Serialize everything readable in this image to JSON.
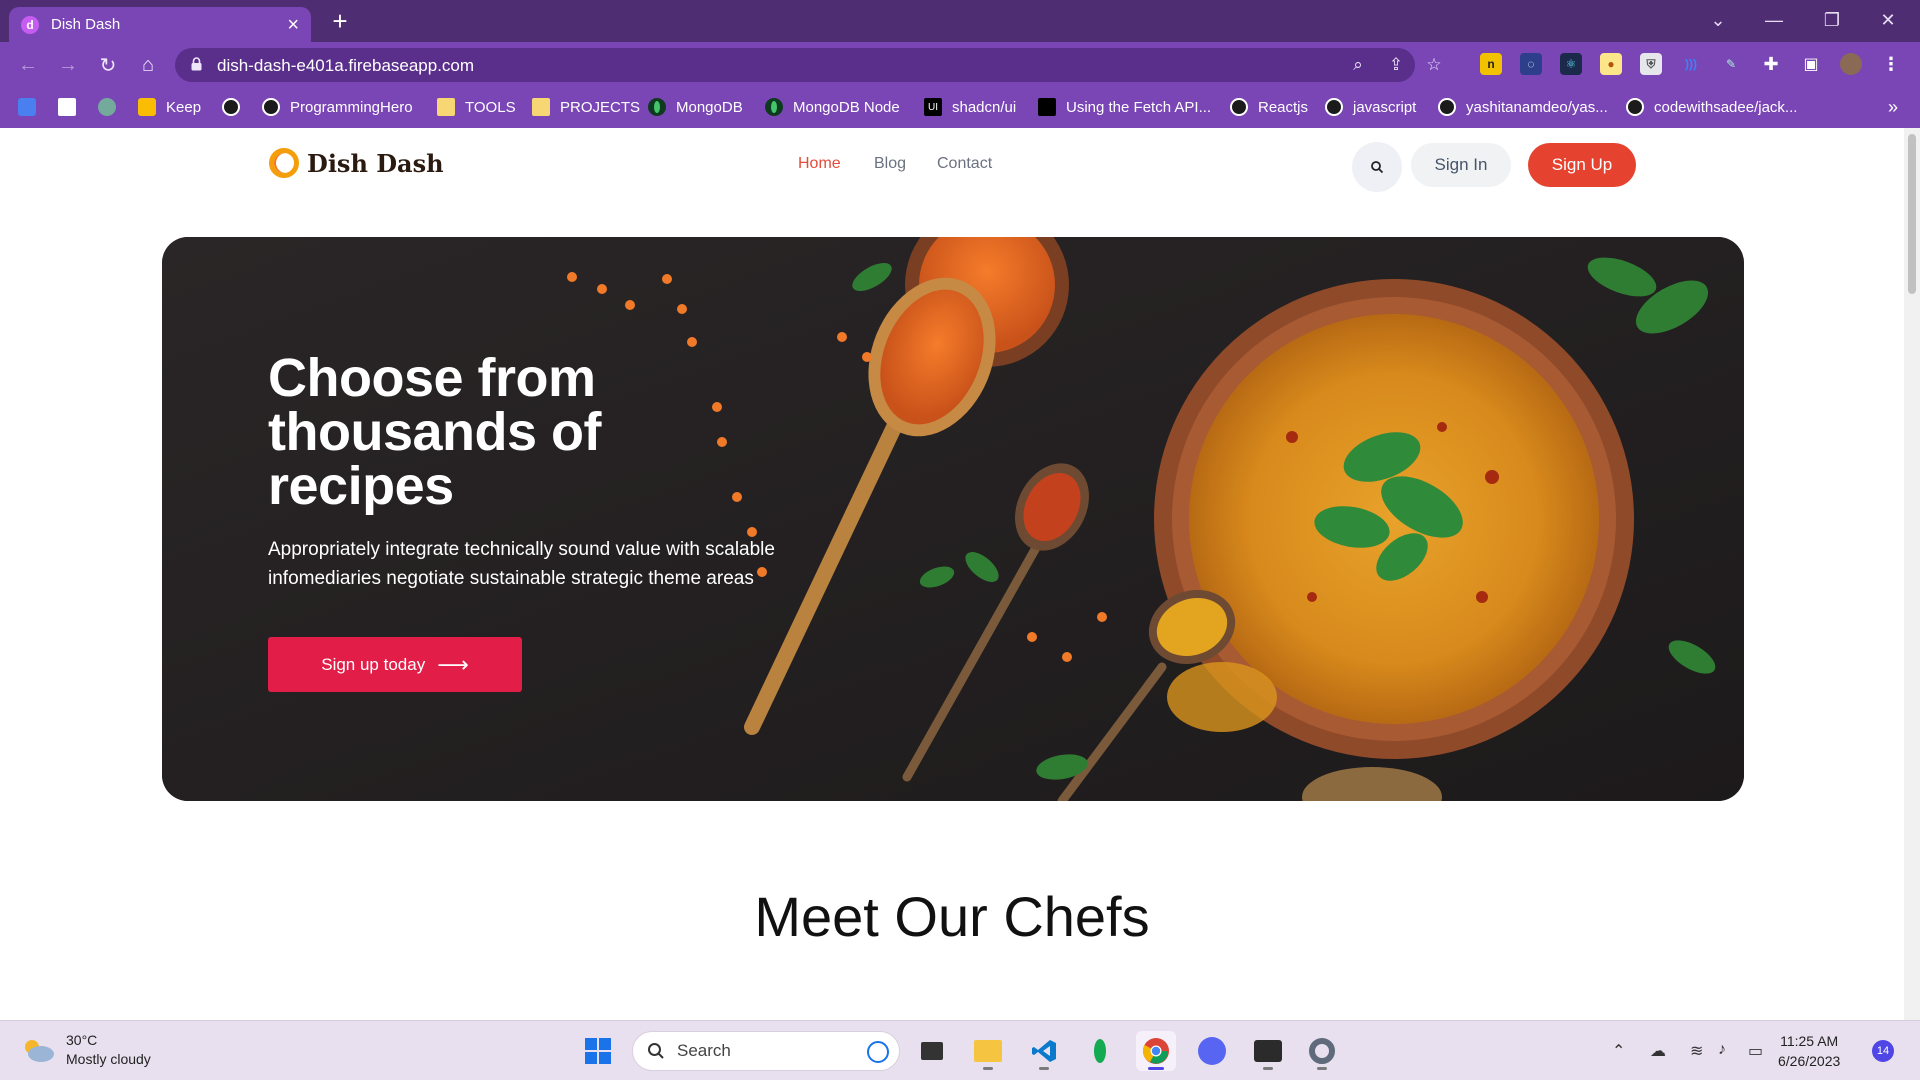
{
  "browser": {
    "tab_title": "Dish Dash",
    "tab_favicon_letter": "d",
    "url": "dish-dash-e401a.firebaseapp.com",
    "bookmarks": [
      "Keep",
      "ProgrammingHero",
      "TOOLS",
      "PROJECTS",
      "MongoDB",
      "MongoDB Node",
      "shadcn/ui",
      "Using the Fetch API...",
      "Reactjs",
      "javascript",
      "yashitanamdeo/yas...",
      "codewithsadee/jack..."
    ],
    "bookmark_ui_label": "UI",
    "bookmark_more": "»",
    "colors": {
      "titlebar": "#4f2d73",
      "toolbar": "#7a45b5",
      "omnibox": "#5a2f8c"
    }
  },
  "site": {
    "logo_text": "Dish Dash",
    "nav": {
      "home": "Home",
      "blog": "Blog",
      "contact": "Contact"
    },
    "sign_in": "Sign In",
    "sign_up": "Sign Up",
    "colors": {
      "accent": "#e5432f",
      "cta": "#e11d48"
    }
  },
  "hero": {
    "title": "Choose from thousands of recipes",
    "text": "Appropriately integrate technically sound value with scalable infomediaries negotiate sustainable strategic theme areas",
    "cta": "Sign up today",
    "cta_arrow": "⟶"
  },
  "sections": {
    "chefs_title": "Meet Our Chefs"
  },
  "taskbar": {
    "weather_temp": "30°C",
    "weather_desc": "Mostly cloudy",
    "search_label": "Search",
    "time": "11:25 AM",
    "date": "6/26/2023",
    "notifications": "14"
  }
}
